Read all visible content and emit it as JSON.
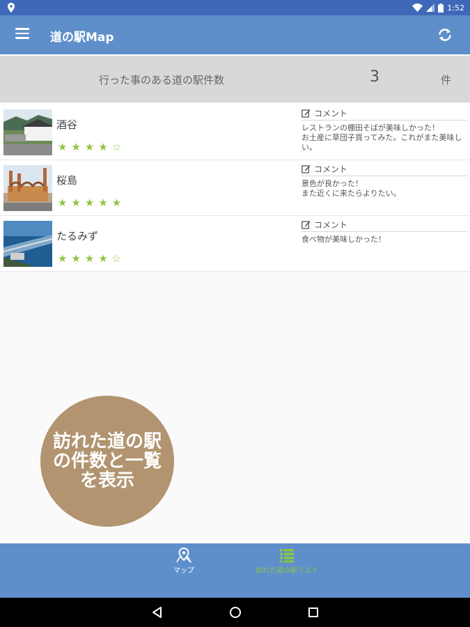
{
  "status_bar": {
    "time": "1:52",
    "icons": [
      "location-icon",
      "wifi-icon",
      "signal-icon",
      "battery-icon"
    ]
  },
  "app_bar": {
    "title": "道の駅Map",
    "menu_icon": "menu-icon",
    "refresh_icon": "refresh-icon"
  },
  "summary": {
    "label": "行った事のある道の駅件数",
    "count": "3",
    "unit": "件"
  },
  "stations": [
    {
      "name": "酒谷",
      "stars": "★★★★☆",
      "rating": 4,
      "comment_header": "コメント",
      "comment": "レストランの棚田そばが美味しかった！\nお土産に草団子買ってみた。これがまた美味しい。"
    },
    {
      "name": "桜島",
      "stars": "★★★★★",
      "rating": 5,
      "comment_header": "コメント",
      "comment": "景色が良かった！\nまた近くに来たらよりたい。"
    },
    {
      "name": "たるみず",
      "stars": "★★★★☆",
      "rating": 4,
      "comment_header": "コメント",
      "comment": "食べ物が美味しかった！"
    }
  ],
  "promo": {
    "text": "訪れた道の駅\nの件数と一覧\nを表示"
  },
  "bottom_nav": {
    "tabs": [
      {
        "label": "マップ",
        "icon": "map-pin-icon",
        "active": false
      },
      {
        "label": "訪れた道の駅リスト",
        "icon": "list-icon",
        "active": true
      }
    ]
  },
  "colors": {
    "status_bar": "#3f69b8",
    "app_bar": "#5e8fcb",
    "accent_green": "#8cc63f",
    "promo": "#b29470",
    "summary_bg": "#d8d8d8"
  }
}
